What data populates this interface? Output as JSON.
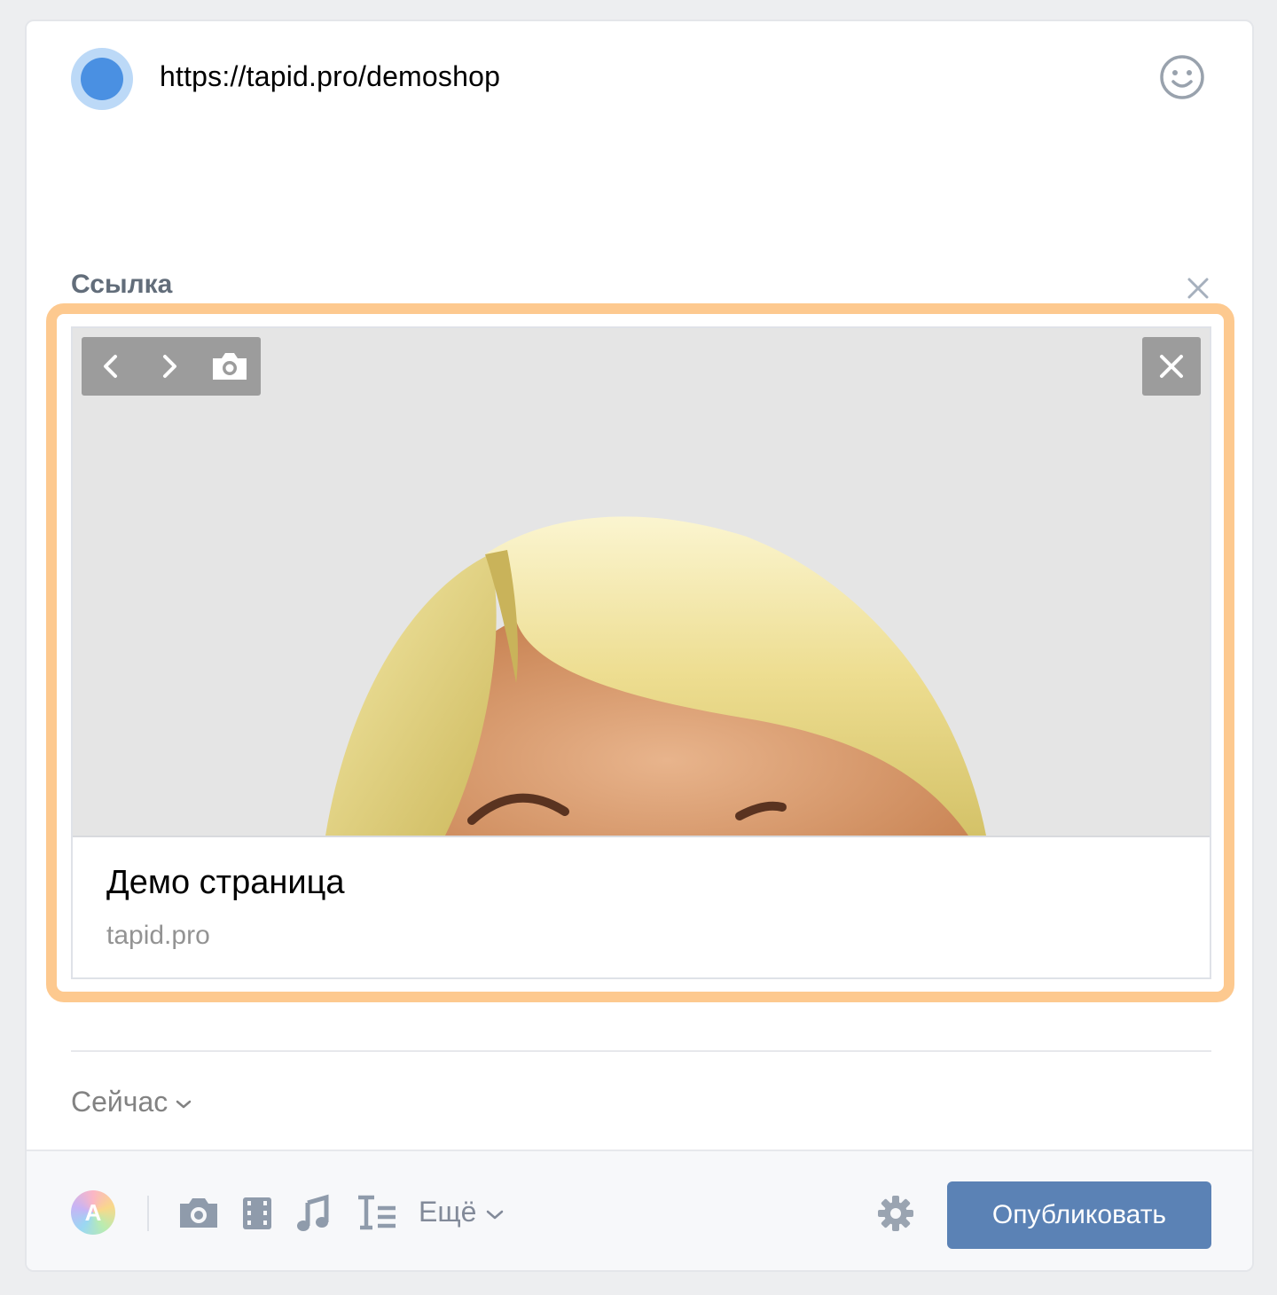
{
  "post": {
    "text": "https://tapid.pro/demoshop"
  },
  "attachment": {
    "section_title": "Ссылка",
    "preview_title": "Демо страница",
    "preview_domain": "tapid.pro"
  },
  "schedule": {
    "time_label": "Сейчас"
  },
  "toolbar": {
    "more_label": "Ещё",
    "author_initial": "A",
    "publish_label": "Опубликовать"
  },
  "colors": {
    "accent": "#5b82b5",
    "highlight": "#fdc98f",
    "avatar": "#4a90e2"
  }
}
